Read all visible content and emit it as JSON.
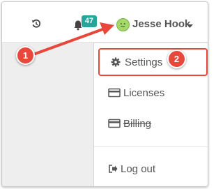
{
  "header": {
    "history_icon": "history-icon",
    "bell_icon": "bell-icon",
    "notification_count": "47",
    "user_name": "Jesse Hook",
    "caret_icon": "caret-down-icon"
  },
  "menu": {
    "items": [
      {
        "label": "Settings",
        "icon": "gear-icon"
      },
      {
        "label": "Licenses",
        "icon": "card-icon"
      },
      {
        "label": "Billing",
        "icon": "card-icon"
      },
      {
        "label": "Log out",
        "icon": "sign-out-icon"
      }
    ]
  },
  "annotations": {
    "marker_1": "1",
    "marker_2": "2"
  },
  "colors": {
    "accent": "#e8473b",
    "badge": "#26a69a",
    "avatar": "#a5d86b"
  }
}
